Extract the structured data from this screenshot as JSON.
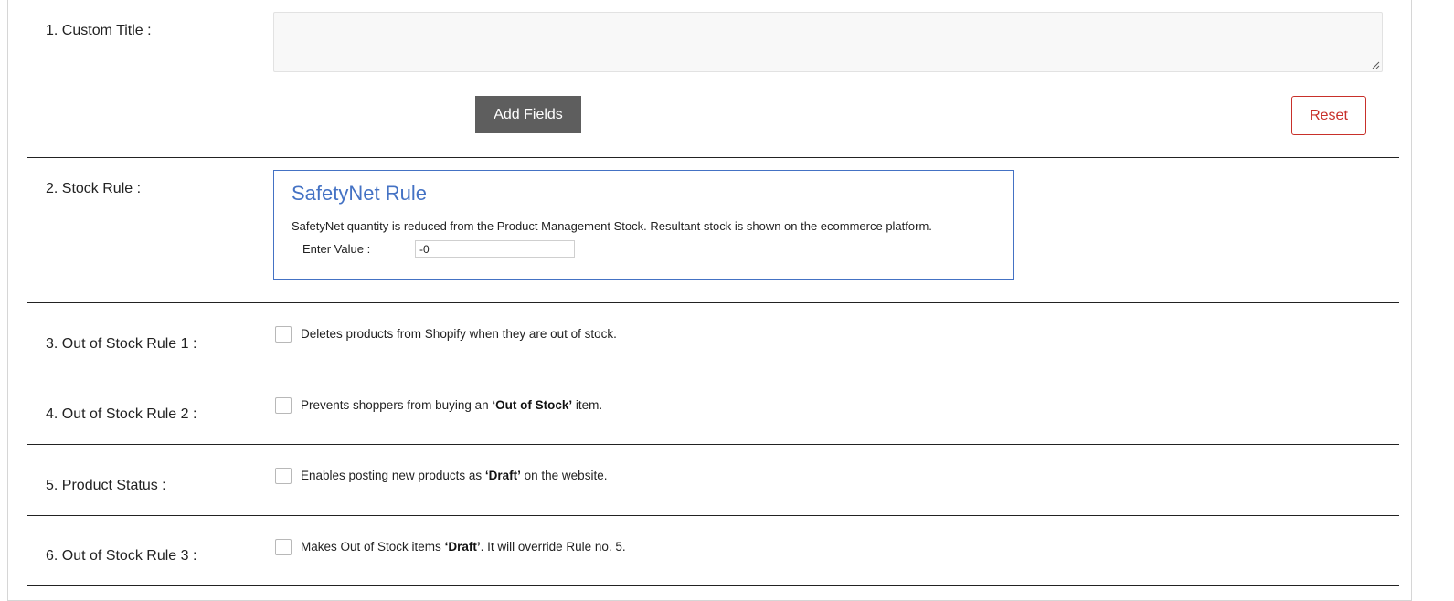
{
  "custom_title": {
    "label": "1. Custom Title :",
    "value": "",
    "add_fields_label": "Add Fields",
    "reset_label": "Reset"
  },
  "stock_rule": {
    "label": "2. Stock Rule :",
    "rule_title": "SafetyNet Rule",
    "rule_description": "SafetyNet quantity is reduced from the Product Management Stock. Resultant stock is shown on the ecommerce platform.",
    "enter_value_label": "Enter Value :",
    "enter_value": "-0"
  },
  "rules": [
    {
      "label": "3. Out of Stock Rule 1 :",
      "checked": false,
      "text_before": "Deletes products from Shopify when they are out of stock.",
      "text_bold": "",
      "text_after": ""
    },
    {
      "label": "4. Out of Stock Rule 2 :",
      "checked": false,
      "text_before": "Prevents shoppers from buying an ",
      "text_bold": "‘Out of Stock’",
      "text_after": " item."
    },
    {
      "label": "5. Product Status :",
      "checked": false,
      "text_before": "Enables posting new products as ",
      "text_bold": "‘Draft’",
      "text_after": " on the website."
    },
    {
      "label": "6. Out of Stock Rule 3 :",
      "checked": false,
      "text_before": "Makes Out of Stock items ",
      "text_bold": "‘Draft’",
      "text_after": ". It will override Rule no. 5."
    }
  ],
  "colors": {
    "accent_blue": "#4472c4",
    "reset_red": "#c8302a",
    "button_gray": "#5e5e5e"
  }
}
